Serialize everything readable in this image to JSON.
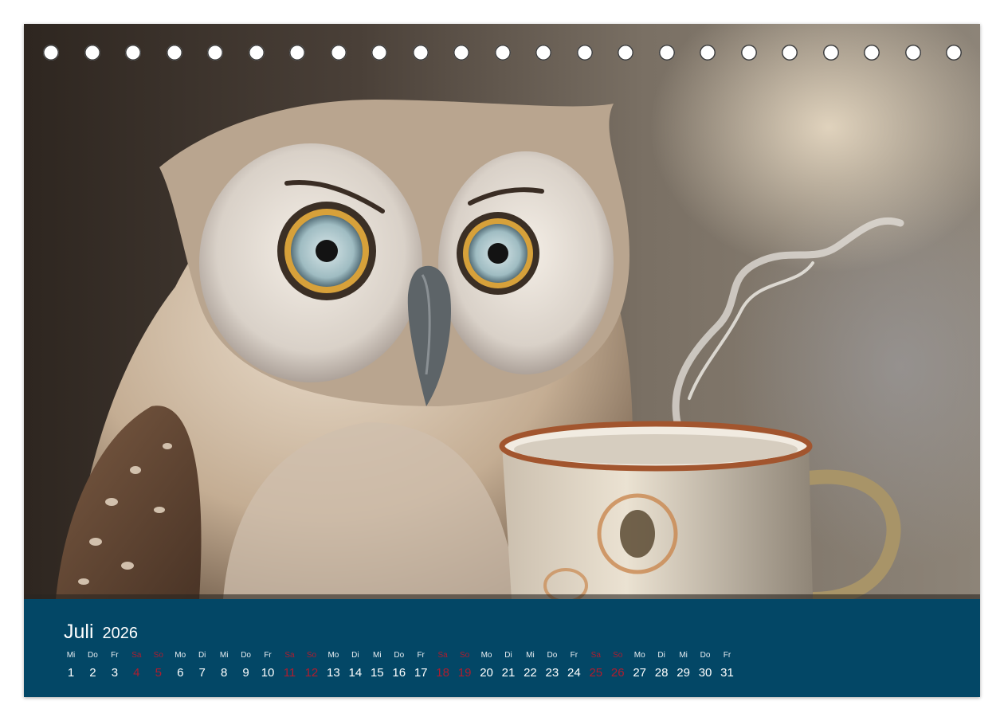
{
  "calendar": {
    "month": "Juli",
    "year": "2026",
    "days": [
      {
        "name": "Mi",
        "num": "1",
        "weekend": false
      },
      {
        "name": "Do",
        "num": "2",
        "weekend": false
      },
      {
        "name": "Fr",
        "num": "3",
        "weekend": false
      },
      {
        "name": "Sa",
        "num": "4",
        "weekend": true
      },
      {
        "name": "So",
        "num": "5",
        "weekend": true
      },
      {
        "name": "Mo",
        "num": "6",
        "weekend": false
      },
      {
        "name": "Di",
        "num": "7",
        "weekend": false
      },
      {
        "name": "Mi",
        "num": "8",
        "weekend": false
      },
      {
        "name": "Do",
        "num": "9",
        "weekend": false
      },
      {
        "name": "Fr",
        "num": "10",
        "weekend": false
      },
      {
        "name": "Sa",
        "num": "11",
        "weekend": true
      },
      {
        "name": "So",
        "num": "12",
        "weekend": true
      },
      {
        "name": "Mo",
        "num": "13",
        "weekend": false
      },
      {
        "name": "Di",
        "num": "14",
        "weekend": false
      },
      {
        "name": "Mi",
        "num": "15",
        "weekend": false
      },
      {
        "name": "Do",
        "num": "16",
        "weekend": false
      },
      {
        "name": "Fr",
        "num": "17",
        "weekend": false
      },
      {
        "name": "Sa",
        "num": "18",
        "weekend": true
      },
      {
        "name": "So",
        "num": "19",
        "weekend": true
      },
      {
        "name": "Mo",
        "num": "20",
        "weekend": false
      },
      {
        "name": "Di",
        "num": "21",
        "weekend": false
      },
      {
        "name": "Mi",
        "num": "22",
        "weekend": false
      },
      {
        "name": "Do",
        "num": "23",
        "weekend": false
      },
      {
        "name": "Fr",
        "num": "24",
        "weekend": false
      },
      {
        "name": "Sa",
        "num": "25",
        "weekend": true
      },
      {
        "name": "So",
        "num": "26",
        "weekend": true
      },
      {
        "name": "Mo",
        "num": "27",
        "weekend": false
      },
      {
        "name": "Di",
        "num": "28",
        "weekend": false
      },
      {
        "name": "Mi",
        "num": "29",
        "weekend": false
      },
      {
        "name": "Do",
        "num": "30",
        "weekend": false
      },
      {
        "name": "Fr",
        "num": "31",
        "weekend": false
      }
    ]
  },
  "colors": {
    "footer_background": "#034766",
    "weekday_text": "#ffffff",
    "weekend_text": "#b01c2e"
  },
  "illustration": {
    "subject": "owl-with-steaming-coffee-cup"
  }
}
